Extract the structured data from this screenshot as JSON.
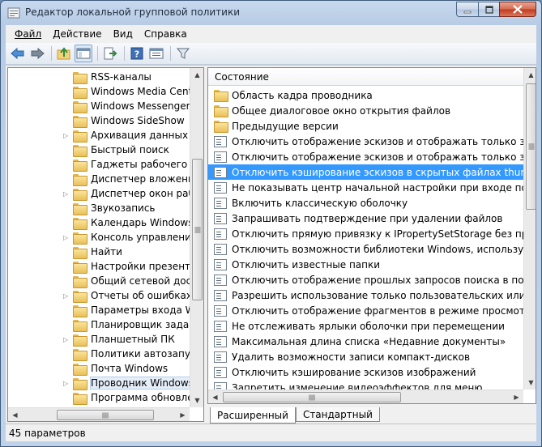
{
  "window": {
    "title": "Редактор локальной групповой политики"
  },
  "menu": [
    {
      "label": "Файл"
    },
    {
      "label": "Действие"
    },
    {
      "label": "Вид"
    },
    {
      "label": "Справка"
    }
  ],
  "toolbar": {
    "icons": [
      "back-arrow-icon",
      "forward-arrow-icon",
      "up-folder-icon",
      "show-hide-tree-icon",
      "export-list-icon",
      "help-icon",
      "properties-icon",
      "filter-icon"
    ]
  },
  "tree": {
    "items": [
      {
        "label": "RSS-каналы",
        "expandable": false
      },
      {
        "label": "Windows Media Cente",
        "expandable": false
      },
      {
        "label": "Windows Messenger",
        "expandable": false
      },
      {
        "label": "Windows SideShow",
        "expandable": false
      },
      {
        "label": "Архивация данных",
        "expandable": true
      },
      {
        "label": "Быстрый поиск",
        "expandable": false
      },
      {
        "label": "Гаджеты рабочего сто",
        "expandable": false
      },
      {
        "label": "Диспетчер вложений",
        "expandable": false
      },
      {
        "label": "Диспетчер окон рабо",
        "expandable": true
      },
      {
        "label": "Звукозапись",
        "expandable": false
      },
      {
        "label": "Календарь Windows",
        "expandable": false
      },
      {
        "label": "Консоль управления",
        "expandable": true
      },
      {
        "label": "Найти",
        "expandable": false
      },
      {
        "label": "Настройки презентаци",
        "expandable": false
      },
      {
        "label": "Общий сетевой досту",
        "expandable": false
      },
      {
        "label": "Отчеты об ошибках W",
        "expandable": true
      },
      {
        "label": "Параметры входа Wir",
        "expandable": false
      },
      {
        "label": "Планировщик задани",
        "expandable": false
      },
      {
        "label": "Планшетный ПК",
        "expandable": true
      },
      {
        "label": "Политики автозапуск",
        "expandable": false
      },
      {
        "label": "Почта Windows",
        "expandable": false
      },
      {
        "label": "Проводник Windows.",
        "expandable": true,
        "selected": true
      },
      {
        "label": "Программа обновлен",
        "expandable": false
      }
    ]
  },
  "list": {
    "column_header": "Состояние",
    "rows": [
      {
        "label": "Область кадра проводника",
        "type": "folder"
      },
      {
        "label": "Общее диалоговое окно открытия файлов",
        "type": "folder"
      },
      {
        "label": "Предыдущие версии",
        "type": "folder"
      },
      {
        "label": "Отключить отображение эскизов и отображать только значки.",
        "type": "policy"
      },
      {
        "label": "Отключить отображение эскизов и отображать только значки в се",
        "type": "policy"
      },
      {
        "label": "Отключить кэширование эскизов в скрытых файлах thumbs.db",
        "type": "policy",
        "selected": true
      },
      {
        "label": "Не показывать центр начальной настройки при входе пользовател",
        "type": "policy"
      },
      {
        "label": "Включить классическую оболочку",
        "type": "policy"
      },
      {
        "label": "Запрашивать подтверждение при удалении файлов",
        "type": "policy"
      },
      {
        "label": "Отключить прямую привязку к IPropertySetStorage без промежуто",
        "type": "policy"
      },
      {
        "label": "Отключить возможности библиотеки Windows, использующие да",
        "type": "policy"
      },
      {
        "label": "Отключить известные папки",
        "type": "policy"
      },
      {
        "label": "Отключить отображение прошлых запросов поиска в поле поиска",
        "type": "policy"
      },
      {
        "label": "Разрешить использование только пользовательских или зарегистр",
        "type": "policy"
      },
      {
        "label": "Отключить отображение фрагментов в режиме просмотра содер",
        "type": "policy"
      },
      {
        "label": "Не отслеживать ярлыки оболочки при перемещении",
        "type": "policy"
      },
      {
        "label": "Максимальная длина списка «Недавние документы»",
        "type": "policy"
      },
      {
        "label": "Удалить возможности записи компакт-дисков",
        "type": "policy"
      },
      {
        "label": "Отключить кэширование эскизов изображений",
        "type": "policy"
      },
      {
        "label": "Запретить изменение видеоэффектов для меню",
        "type": "policy"
      }
    ]
  },
  "tabs": [
    {
      "label": "Расширенный",
      "active": true
    },
    {
      "label": "Стандартный",
      "active": false
    }
  ],
  "status": {
    "text": "45 параметров"
  },
  "colors": {
    "selection": "#3399ff",
    "window_frame": "#bfd2ea"
  }
}
